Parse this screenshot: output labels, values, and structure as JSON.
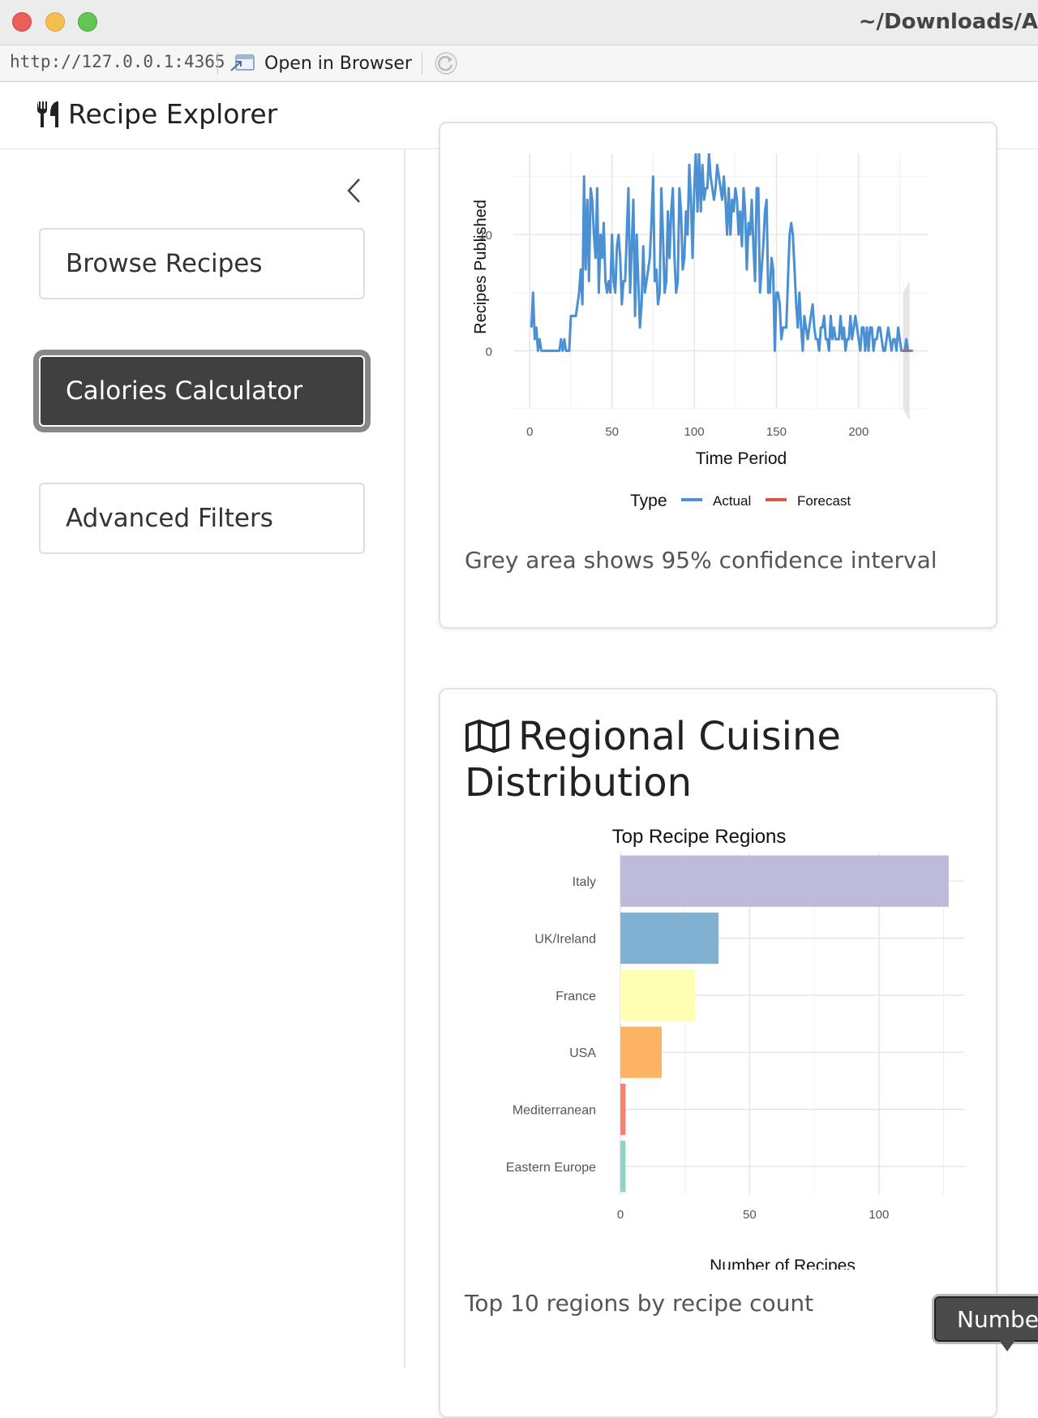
{
  "window": {
    "title": "~/Downloads/A",
    "url": "http://127.0.0.1:4365",
    "open_in_browser": "Open in Browser"
  },
  "app": {
    "title": "Recipe Explorer",
    "icon": "utensils-icon"
  },
  "sidebar": {
    "items": [
      {
        "label": "Browse Recipes",
        "active": false
      },
      {
        "label": "Calories Calculator",
        "active": true
      },
      {
        "label": "Advanced Filters",
        "active": false
      }
    ]
  },
  "trend_card": {
    "caption": "Grey area shows 95% confidence interval"
  },
  "region_card": {
    "title": "Regional Cuisine Distribution",
    "icon": "map-icon",
    "caption": "Top 10 regions by recipe count"
  },
  "tooltip": {
    "text": "Number"
  },
  "chart_data": [
    {
      "type": "line",
      "xlabel": "Time Period",
      "ylabel": "Recipes Published",
      "xlim": [
        -10,
        242
      ],
      "ylim": [
        -5,
        17
      ],
      "x_ticks": [
        0,
        50,
        100,
        150,
        200
      ],
      "y_ticks": [
        0,
        10
      ],
      "legend": {
        "title": "Type",
        "placement": "bottom"
      },
      "series": [
        {
          "name": "Actual",
          "color": "#4a90d2",
          "x_start": 1,
          "values": [
            2,
            5,
            1,
            2,
            0,
            1,
            0,
            0,
            0,
            0,
            0,
            0,
            0,
            0,
            0,
            0,
            0,
            0,
            1,
            0,
            1,
            0,
            0,
            0,
            3,
            3,
            3,
            3,
            4,
            5,
            7,
            4,
            15,
            7,
            13,
            6,
            14,
            13,
            10,
            8,
            14,
            5,
            10,
            8,
            11,
            6,
            5,
            6,
            5,
            10,
            6,
            5,
            9,
            10,
            8,
            4,
            6,
            6,
            10,
            14,
            5,
            9,
            13,
            3,
            10,
            6,
            2,
            4,
            9,
            5,
            6,
            7,
            8,
            11,
            15,
            6,
            7,
            4,
            5,
            14,
            10,
            5,
            6,
            12,
            8,
            12,
            14,
            8,
            5,
            6,
            14,
            12,
            7,
            8,
            12,
            10,
            16,
            13,
            8,
            14,
            17,
            12,
            17,
            12,
            16,
            13,
            14,
            14,
            17,
            15,
            14,
            13,
            14,
            16,
            15,
            14,
            13,
            15,
            13,
            10,
            14,
            10,
            13,
            12,
            14,
            13,
            10,
            12,
            9,
            14,
            12,
            7,
            11,
            10,
            13,
            9,
            6,
            14,
            14,
            5,
            7,
            9,
            12,
            13,
            5,
            5,
            8,
            7,
            0,
            5,
            5,
            4,
            1,
            2,
            2,
            2,
            6,
            10,
            11,
            10,
            7,
            4,
            2,
            5,
            2,
            0,
            3,
            2,
            1,
            2,
            3,
            4,
            2,
            1,
            1,
            0,
            2,
            2,
            3,
            1,
            1,
            0,
            3,
            1,
            2,
            1,
            1,
            1,
            3,
            1,
            2,
            0,
            1,
            1,
            3,
            1,
            2,
            3,
            2,
            1,
            0,
            2,
            2,
            0,
            2,
            0,
            2,
            2,
            0,
            1,
            1,
            2,
            2,
            1,
            0,
            0,
            1,
            2,
            1,
            0,
            1,
            1,
            0,
            2,
            1,
            0,
            0,
            0,
            1,
            0,
            0,
            0,
            0
          ]
        },
        {
          "name": "Forecast",
          "color": "#d9574a",
          "x": [
            227,
            231
          ],
          "values": [
            0,
            0
          ],
          "confidence_interval": {
            "lower": -6,
            "upper": 6
          }
        }
      ]
    },
    {
      "type": "bar",
      "orientation": "horizontal",
      "title": "Top Recipe Regions",
      "xlabel": "Number of Recipes",
      "ylabel": "",
      "xlim": [
        0,
        133
      ],
      "x_ticks": [
        0,
        50,
        100
      ],
      "categories": [
        "Italy",
        "UK/Ireland",
        "France",
        "USA",
        "Mediterranean",
        "Eastern Europe"
      ],
      "values": [
        127,
        38,
        29,
        16,
        2,
        2
      ],
      "colors": [
        "#bebada",
        "#80b1d3",
        "#ffffb3",
        "#fdb462",
        "#fb8072",
        "#8dd3c7"
      ]
    }
  ]
}
